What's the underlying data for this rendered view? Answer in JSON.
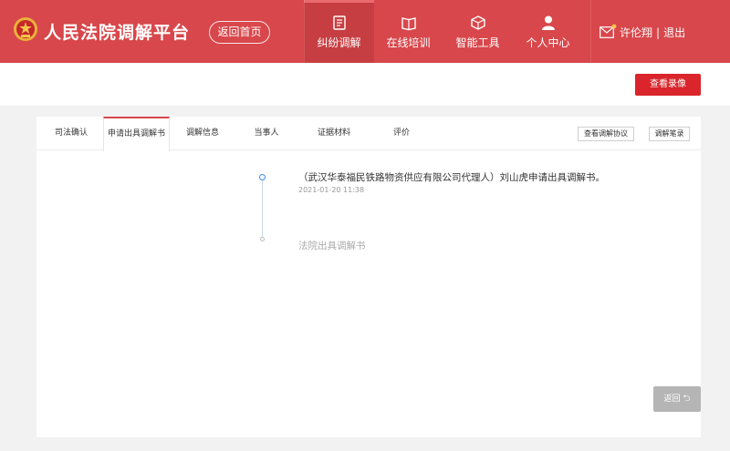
{
  "header": {
    "brand": "人民法院调解平台",
    "home_button": "返回首页",
    "nav": [
      {
        "label": "纠纷调解",
        "icon": "document-edit-icon",
        "active": true
      },
      {
        "label": "在线培训",
        "icon": "book-icon",
        "active": false
      },
      {
        "label": "智能工具",
        "icon": "cube-icon",
        "active": false
      },
      {
        "label": "个人中心",
        "icon": "user-icon",
        "active": false
      }
    ],
    "user_name": "许伦翔",
    "separator": "|",
    "logout": "退出"
  },
  "toolbar": {
    "video_button": "查看录像"
  },
  "panel": {
    "tabs": [
      {
        "label": "司法确认"
      },
      {
        "label": "申请出具调解书",
        "active": true
      },
      {
        "label": "调解信息"
      },
      {
        "label": "当事人"
      },
      {
        "label": "证据材料"
      },
      {
        "label": "评价"
      }
    ],
    "view_agreement_button": "查看调解协议",
    "notes_button": "调解笔录"
  },
  "timeline": [
    {
      "text": "（武汉华泰福民铁路物资供应有限公司代理人）刘山虎申请出具调解书。",
      "time": "2021-01-20 11:38"
    },
    {
      "text": "法院出具调解书",
      "time": ""
    }
  ],
  "back_button": "返回",
  "colors": {
    "header_bg": "#d8474b",
    "accent_red": "#d9252b",
    "timeline_blue": "#3f8fe0"
  }
}
